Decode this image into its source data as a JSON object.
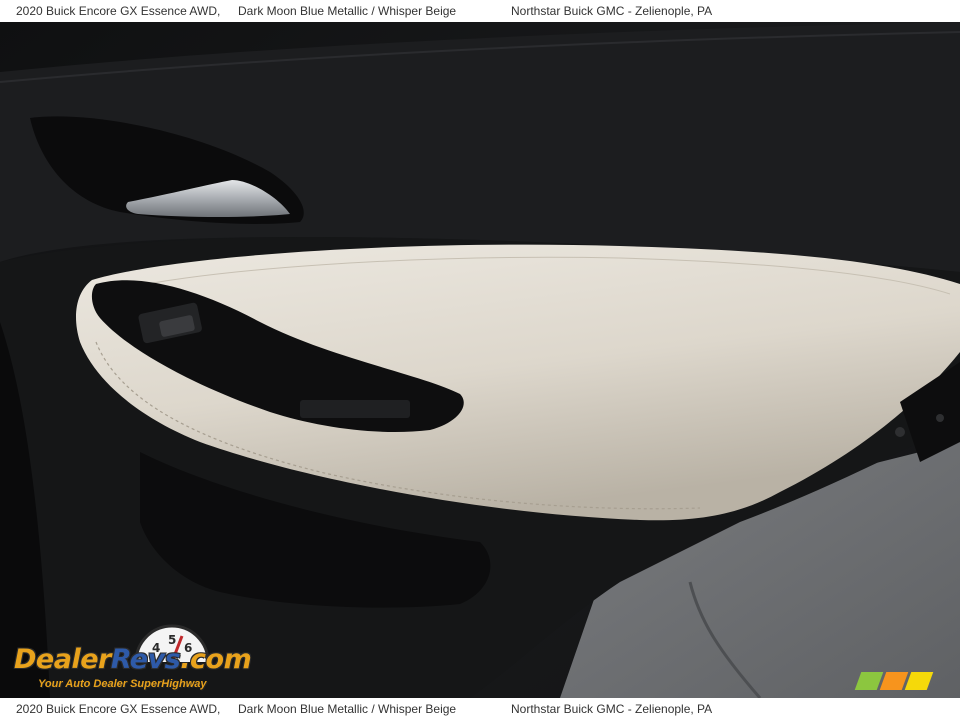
{
  "caption": {
    "vehicle": "2020 Buick Encore GX Essence AWD,",
    "colors": "Dark Moon Blue Metallic / Whisper Beige",
    "dealer": "Northstar Buick GMC - Zelienople, PA"
  },
  "watermark": {
    "logo_main": "Dealer",
    "logo_accent": "Revs",
    "logo_suffix": ".com",
    "tagline": "Your Auto Dealer SuperHighway",
    "gauge_digits": "456"
  },
  "colors": {
    "door_black": "#161718",
    "trim_beige": "#dcd6cc",
    "handle_chrome": "#b9bcc0",
    "pavement": "#6f7174",
    "logo_orange": "#e8a21c",
    "logo_blue": "#2e5aa8",
    "corner_colors": [
      "#8cc63f",
      "#f7941d",
      "#f5d90a"
    ]
  }
}
